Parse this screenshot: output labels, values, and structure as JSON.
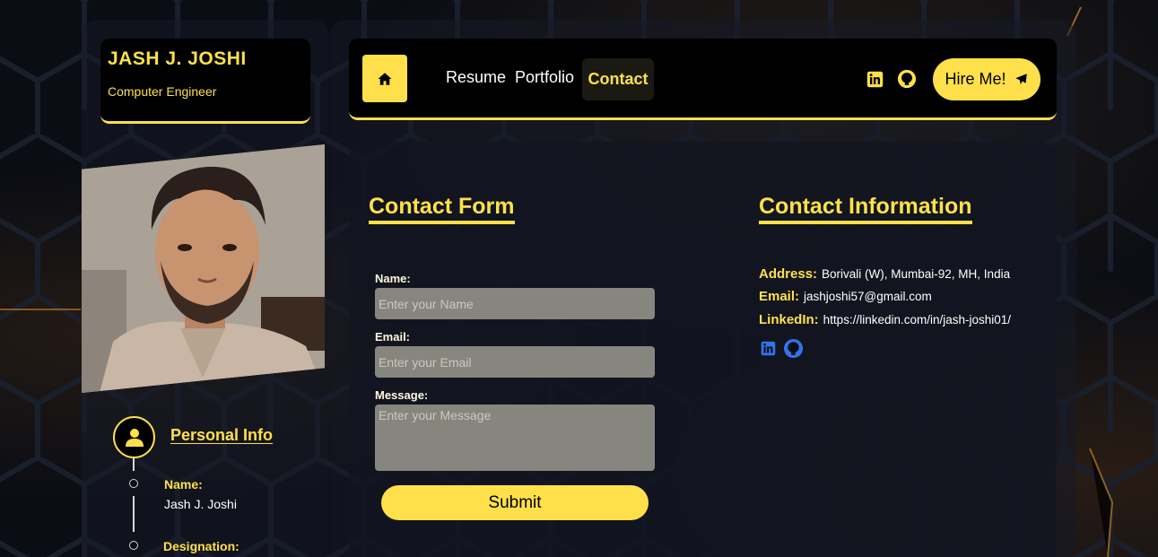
{
  "sidebar": {
    "name": "JASH J. JOSHI",
    "role": "Computer Engineer",
    "personal_info_title": "Personal Info",
    "fields": [
      {
        "label": "Name:",
        "value": "Jash J. Joshi"
      },
      {
        "label": "Designation:",
        "value": ""
      }
    ]
  },
  "nav": {
    "home_icon": "home-icon",
    "links": [
      "Resume",
      "Portfolio",
      "Contact"
    ],
    "active": "Contact",
    "hire_label": "Hire Me!",
    "social_icons": [
      "linkedin-icon",
      "github-icon"
    ]
  },
  "contact_form": {
    "title": "Contact Form",
    "name_label": "Name:",
    "name_placeholder": "Enter your Name",
    "email_label": "Email:",
    "email_placeholder": "Enter your Email",
    "message_label": "Message:",
    "message_placeholder": "Enter your Message",
    "submit_label": "Submit"
  },
  "contact_info": {
    "title": "Contact Information",
    "address_label": "Address:",
    "address": "Borivali (W), Mumbai-92, MH, India",
    "email_label": "Email:",
    "email": "jashjoshi57@gmail.com",
    "linkedin_label": "LinkedIn:",
    "linkedin": "https://linkedin.com/in/jash-joshi01/"
  },
  "colors": {
    "accent": "#ffe04a",
    "background": "#0b0d14",
    "social_blue": "#2f74e8"
  }
}
